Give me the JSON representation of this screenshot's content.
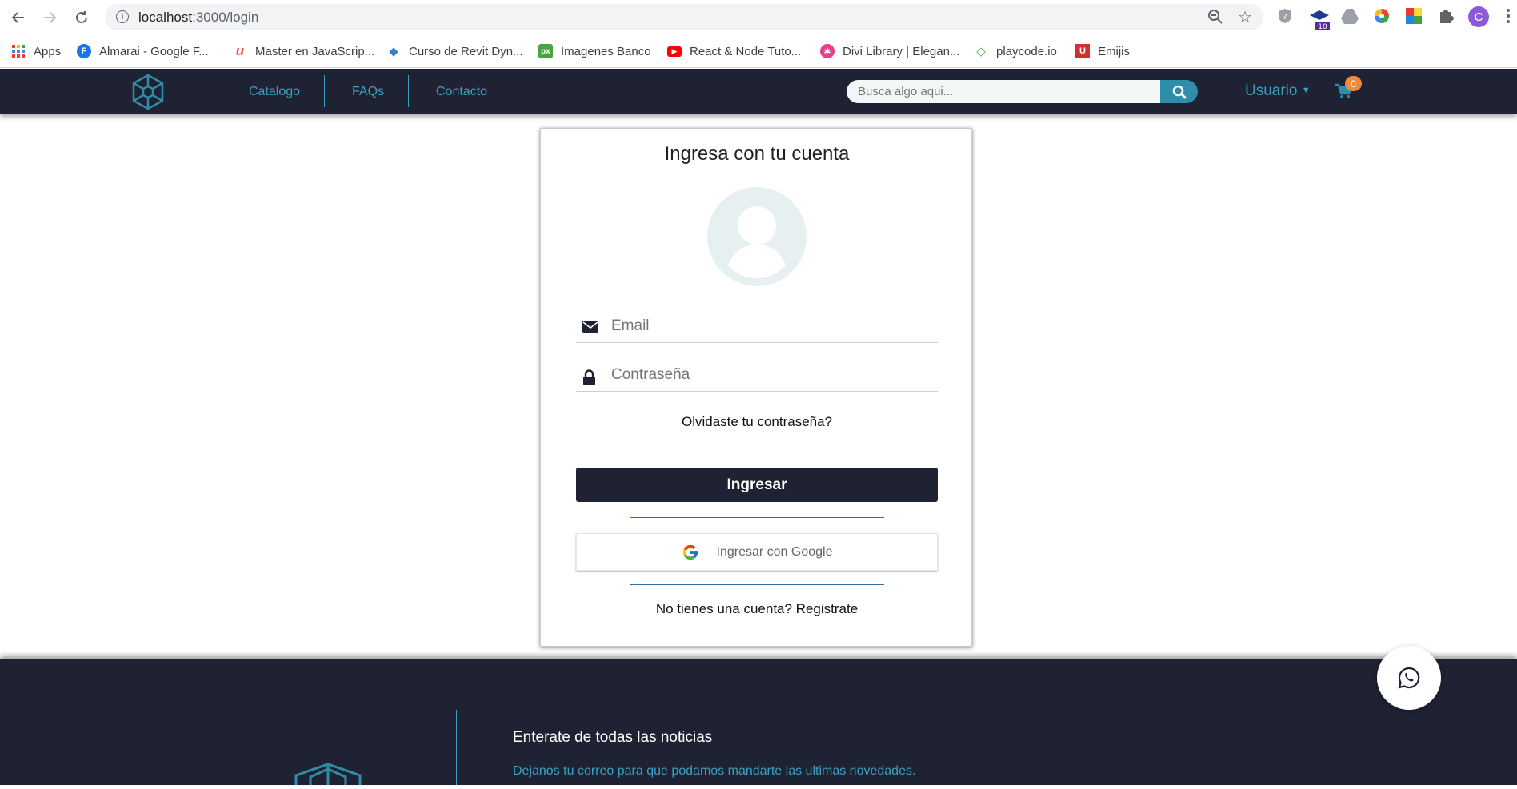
{
  "browser": {
    "url_host": "localhost",
    "url_path": ":3000/login",
    "profile_initial": "C",
    "extension_badge": "10"
  },
  "bookmarks": [
    {
      "label": "Apps",
      "icon": "apps-grid-icon",
      "color": "#4285f4"
    },
    {
      "label": "Almarai - Google F...",
      "icon": "google-fonts-icon",
      "color": "#1a73e8",
      "glyph": "F"
    },
    {
      "label": "Master en JavaScrip...",
      "icon": "udemy-icon",
      "color": "#ec5252",
      "glyph": "u"
    },
    {
      "label": "Curso de Revit Dyn...",
      "icon": "dynamo-icon",
      "color": "#3b82c4",
      "glyph": "◆"
    },
    {
      "label": "Imagenes Banco",
      "icon": "pixabay-icon",
      "color": "#48a23f",
      "glyph": "px"
    },
    {
      "label": "React & Node Tuto...",
      "icon": "youtube-icon",
      "color": "#ff0000",
      "glyph": "▶"
    },
    {
      "label": "Divi Library | Elegan...",
      "icon": "divi-icon",
      "color": "#e83e8c",
      "glyph": "✱"
    },
    {
      "label": "playcode.io",
      "icon": "playcode-icon",
      "color": "#4caf50",
      "glyph": "◇"
    },
    {
      "label": "Emijis",
      "icon": "unicode-icon",
      "color": "#d32f2f",
      "glyph": "U"
    }
  ],
  "navbar": {
    "links": [
      "Catalogo",
      "FAQs",
      "Contacto"
    ],
    "search_placeholder": "Busca algo aqui...",
    "user_label": "Usuario",
    "cart_count": "0",
    "accent": "#3aa0bf",
    "background": "#1f2233"
  },
  "login": {
    "title": "Ingresa con tu cuenta",
    "email_placeholder": "Email",
    "password_placeholder": "Contraseña",
    "forgot": "Olvidaste tu contraseña?",
    "submit": "Ingresar",
    "google": "Ingresar con Google",
    "signup": "No tienes una cuenta? Registrate"
  },
  "footer": {
    "title": "Enterate de todas las noticias",
    "text": "Dejanos tu correo para que podamos mandarte las ultimas novedades."
  }
}
